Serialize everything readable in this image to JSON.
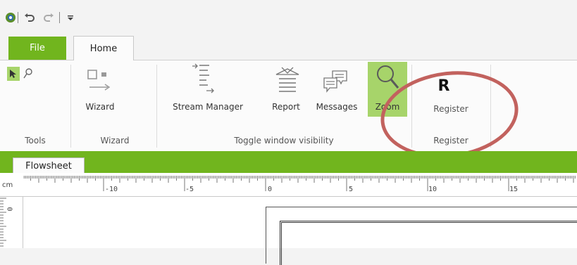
{
  "quick_access": {
    "app_icon": "app-logo-icon",
    "undo_icon": "undo-icon",
    "redo_icon": "redo-icon",
    "customize_icon": "customize-toolbar-icon"
  },
  "tabs": {
    "file": "File",
    "home": "Home"
  },
  "ribbon": {
    "tools": {
      "label": "Tools"
    },
    "wizard": {
      "button": "Wizard",
      "label": "Wizard"
    },
    "toggle": {
      "label": "Toggle window visibility",
      "stream_manager": "Stream Manager",
      "report": "Report",
      "messages": "Messages",
      "zoom": "Zoom"
    },
    "register": {
      "icon_text": "R",
      "button": "Register",
      "label": "Register"
    }
  },
  "flowsheet": {
    "tab": "Flowsheet",
    "ruler_unit": "cm",
    "ruler_labels": [
      "-10",
      "-5",
      "0",
      "5",
      "10",
      "15"
    ],
    "vruler_label": "0"
  },
  "colors": {
    "accent_green": "#71b51e",
    "zoom_active": "#a7d46a",
    "annotation": "#c2625e"
  }
}
